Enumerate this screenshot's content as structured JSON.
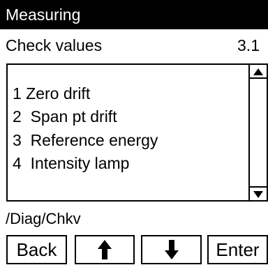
{
  "header": {
    "title": "Measuring"
  },
  "subheader": {
    "title": "Check values",
    "code": "3.1"
  },
  "menu": {
    "items": [
      {
        "label": "1 Zero drift"
      },
      {
        "label": "2  Span pt drift"
      },
      {
        "label": "3  Reference energy"
      },
      {
        "label": "4  Intensity lamp"
      }
    ]
  },
  "path": {
    "text": "/Diag/Chkv"
  },
  "softkeys": {
    "back_label": "Back",
    "up_icon": "arrow-up-icon",
    "down_icon": "arrow-down-icon",
    "enter_label": "Enter"
  },
  "colors": {
    "header_bg": "#000000",
    "header_fg": "#ffffff",
    "background": "#ffffff",
    "border": "#000000"
  }
}
